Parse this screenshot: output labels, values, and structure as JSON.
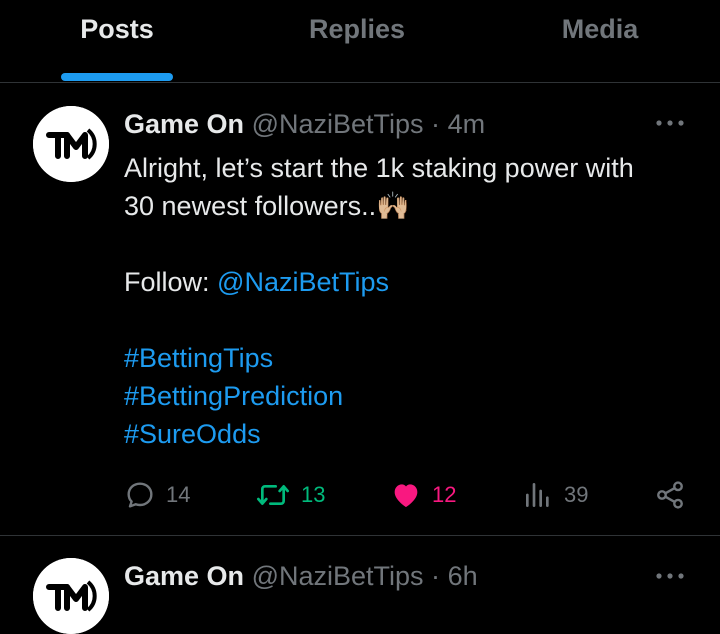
{
  "tabs": [
    {
      "label": "Posts",
      "active": true
    },
    {
      "label": "Replies",
      "active": false
    },
    {
      "label": "Media",
      "active": false
    }
  ],
  "colors": {
    "accent": "#1d9bf0",
    "retweet": "#00ba7c",
    "like": "#f91880",
    "muted": "#71767b"
  },
  "posts": [
    {
      "avatar_icon": "tm-logo",
      "name": "Game On",
      "handle": "@NaziBetTips",
      "separator": "·",
      "time": "4m",
      "text_line1": "Alright, let’s start the 1k staking power with",
      "text_line2": "30 newest followers..🙌🏼",
      "follow_label": "Follow:",
      "follow_handle": "@NaziBetTips",
      "hashtags": [
        "#BettingTips",
        "#BettingPrediction",
        "#SureOdds"
      ],
      "stats": {
        "replies": "14",
        "reposts": "13",
        "likes": "12",
        "views": "39"
      },
      "liked": true
    },
    {
      "avatar_icon": "tm-logo",
      "name": "Game On",
      "handle": "@NaziBetTips",
      "separator": "·",
      "time": "6h"
    }
  ]
}
